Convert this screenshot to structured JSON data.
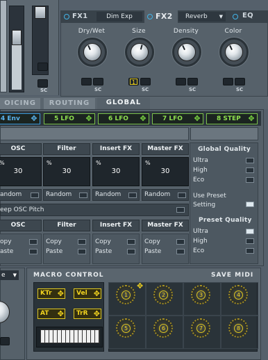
{
  "fx_tabs": {
    "fx1": "FX1",
    "fx1_preset": "Dim Exp",
    "fx2": "FX2",
    "fx2_preset": "Reverb",
    "eq": "EQ"
  },
  "reverb": {
    "knobs": [
      {
        "label": "Dry/Wet"
      },
      {
        "label": "Size",
        "badge": "1"
      },
      {
        "label": "Density"
      },
      {
        "label": "Color"
      }
    ],
    "sc": "SC"
  },
  "env": {
    "sc": "SC"
  },
  "main_tabs": {
    "voicing": "OICING",
    "routing": "ROUTING",
    "global": "GLOBAL"
  },
  "mod_slots": [
    "4 Env",
    "5 LFO",
    "6 LFO",
    "7 LFO",
    "8 STEP"
  ],
  "velocity_section": {
    "headers": [
      "OSC",
      "Filter",
      "Insert FX",
      "Master FX"
    ],
    "percent": "%",
    "values": [
      "30",
      "30",
      "30",
      "30"
    ],
    "random_label": "Random",
    "random_labels": [
      "andom",
      "Random",
      "Random",
      "Random"
    ],
    "keep_osc_pitch": "eep OSC Pitch"
  },
  "copy_section": {
    "headers": [
      "OSC",
      "Filter",
      "Insert FX",
      "Master FX"
    ],
    "copy": "Copy",
    "paste": "Paste",
    "copy_partial": "opy",
    "paste_partial": "aste"
  },
  "global_quality": {
    "title": "Global Quality",
    "options": [
      "Ultra",
      "High",
      "Eco"
    ],
    "use_preset": "Use Preset",
    "setting": "Setting",
    "preset_title": "Preset Quality",
    "preset_options": [
      "Ultra",
      "High",
      "Eco"
    ]
  },
  "macro": {
    "title": "MACRO CONTROL",
    "save": "SAVE MIDI",
    "sources": [
      "KTr",
      "Vel",
      "AT",
      "TrR"
    ],
    "knobs": [
      "1",
      "2",
      "3",
      "4",
      "5",
      "6",
      "7",
      "8"
    ],
    "left_dropdown": "e"
  },
  "colors": {
    "lfo_green": "#7bd642",
    "macro_yellow": "#f3d420",
    "fx_active_blue": "#43b4e8"
  }
}
